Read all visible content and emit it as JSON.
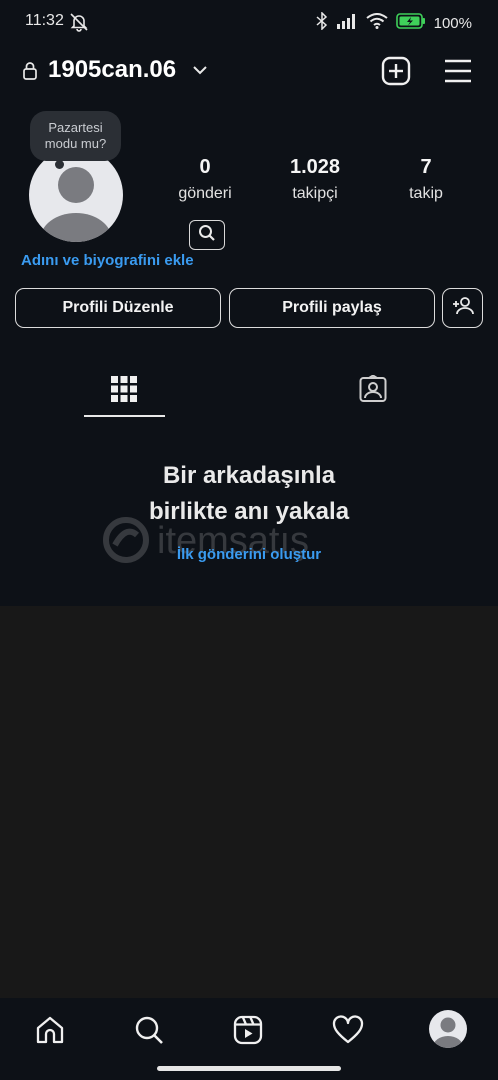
{
  "status_bar": {
    "time": "11:32",
    "battery": "100%",
    "icons": [
      "mute-bell-icon",
      "bluetooth-icon",
      "signal-icon",
      "wifi-icon",
      "battery-icon"
    ]
  },
  "header": {
    "username": "1905can.06",
    "icons": [
      "lock-icon",
      "chevron-down-icon",
      "add-post-icon",
      "menu-icon"
    ]
  },
  "profile": {
    "tooltip_line1": "Pazartesi",
    "tooltip_line2": "modu mu?",
    "stats": [
      {
        "value": "0",
        "label": "gönderi"
      },
      {
        "value": "1.028",
        "label": "takipçi"
      },
      {
        "value": "7",
        "label": "takip"
      }
    ],
    "bio_link": "Adını ve biyografini ekle"
  },
  "actions": {
    "edit_profile": "Profili Düzenle",
    "share_profile": "Profili paylaş"
  },
  "tabs": {
    "icons": [
      "grid-icon",
      "tagged-icon"
    ],
    "active": "grid-icon"
  },
  "empty_state": {
    "title_line1": "Bir arkadaşınla",
    "title_line2": "birlikte anı yakala",
    "link": "İlk gönderini oluştur"
  },
  "watermark": {
    "text": "itemsatış"
  },
  "bottom_nav": {
    "icons": [
      "home-icon",
      "search-icon",
      "reels-icon",
      "heart-icon",
      "profile-avatar-icon"
    ]
  },
  "colors": {
    "background": "#0d1117",
    "accent": "#3a9bf0",
    "lower_panel": "#181818"
  }
}
